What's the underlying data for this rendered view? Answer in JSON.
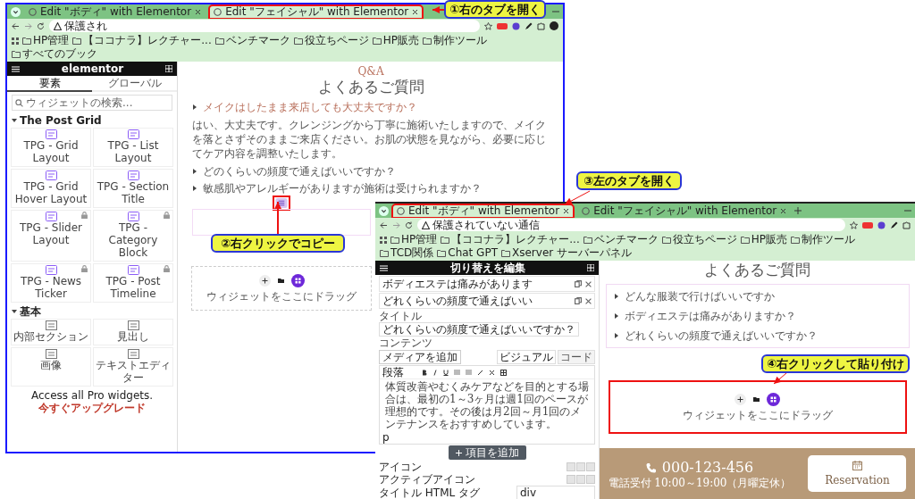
{
  "windows": [
    {
      "kind": "widgets",
      "framed": true,
      "tabs": [
        {
          "label": "Edit \"ボディ\" with Elementor",
          "selected": false,
          "highlighted": false
        },
        {
          "label": "Edit \"フェイシャル\" with Elementor",
          "selected": true,
          "highlighted": true
        }
      ],
      "address": "保護され",
      "bookmarks": [
        "HP管理",
        "【ココナラ】レクチャー...",
        "ベンチマーク",
        "役立ちページ",
        "HP販売",
        "制作ツール"
      ],
      "bookmarks_right": "すべてのブック",
      "panel": {
        "logo": "elementor",
        "tabs": [
          {
            "label": "要素",
            "selected": true
          },
          {
            "label": "グローバル",
            "selected": false
          }
        ],
        "search": {
          "placeholder": "ウィジェットの検索..."
        },
        "sections": [
          {
            "title": "The Post Grid",
            "widgets": [
              {
                "label": "TPG - Grid Layout",
                "locked": false
              },
              {
                "label": "TPG - List Layout",
                "locked": false
              },
              {
                "label": "TPG - Grid Hover Layout",
                "locked": false
              },
              {
                "label": "TPG - Section Title",
                "locked": false
              },
              {
                "label": "TPG - Slider Layout",
                "locked": true
              },
              {
                "label": "TPG - Category Block",
                "locked": true
              },
              {
                "label": "TPG - News Ticker",
                "locked": true
              },
              {
                "label": "TPG - Post Timeline",
                "locked": true
              }
            ]
          },
          {
            "title": "基本",
            "widgets": [
              {
                "label": "内部セクション",
                "locked": false
              },
              {
                "label": "見出し",
                "locked": false
              },
              {
                "label": "画像",
                "locked": false
              },
              {
                "label": "テキストエディター",
                "locked": false
              }
            ]
          }
        ],
        "promo": {
          "text": "Access all Pro widgets.",
          "link": "今すぐアップグレード"
        }
      },
      "page": {
        "eyebrow": "Q&A",
        "heading": "よくあるご質問",
        "faqs": [
          {
            "question": "メイクはしたまま来店しても大丈夫ですか？",
            "expanded": true,
            "answer": "はい、大丈夫です。クレンジングから丁寧に施術いたしますので、メイクを落とさずそのままご来店ください。お肌の状態を見ながら、必要に応じてケア内容を調整いたします。"
          },
          {
            "question": "どのくらいの頻度で通えばいいですか？",
            "expanded": false
          },
          {
            "question": "敏感肌やアレルギーがありますが施術は受けられますか？",
            "expanded": false
          }
        ],
        "handle": {
          "highlighted": true
        },
        "dropzone": {
          "hint": "ウィジェットをここにドラッグ",
          "highlighted": false
        }
      }
    },
    {
      "kind": "editor",
      "framed": false,
      "tabs": [
        {
          "label": "Edit \"ボディ\" with Elementor",
          "selected": true,
          "highlighted": true
        },
        {
          "label": "Edit \"フェイシャル\" with Elementor",
          "selected": false,
          "highlighted": false
        }
      ],
      "address": "保護されていない通信",
      "bookmarks": [
        "HP管理",
        "【ココナラ】レクチャー...",
        "ベンチマーク",
        "役立ちページ",
        "HP販売",
        "制作ツール",
        "TCD関係",
        "Chat GPT",
        "Xserver サーバーパネル"
      ],
      "panel": {
        "title": "切り替えを編集",
        "items": [
          {
            "label": "ボディエステは痛みがあります"
          },
          {
            "label": "どれくらいの頻度で通えばいい"
          }
        ],
        "title_label": "タイトル",
        "title_value": "どれくらいの頻度で通えばいいですか？",
        "content_label": "コンテンツ",
        "media_button": "メディアを追加",
        "editor_tabs": [
          {
            "label": "ビジュアル",
            "selected": true
          },
          {
            "label": "コード",
            "selected": false
          }
        ],
        "format": "段落",
        "body": "体質改善やむくみケアなどを目的とする場合は、最初の1～3ヶ月は週1回のペースが理想的です。その後は月2回～月1回のメンテナンスをおすすめしています。",
        "path": "p",
        "add_button": "項目を追加",
        "controls": [
          {
            "label": "アイコン"
          },
          {
            "label": "アクティブアイコン"
          },
          {
            "label": "タイトル HTML タグ",
            "value": "div"
          }
        ]
      },
      "page": {
        "heading": "よくあるご質問",
        "boxed": true,
        "faqs": [
          {
            "question": "どんな服装で行けばいいですか",
            "expanded": false
          },
          {
            "question": "ボディエステは痛みがありますか？",
            "expanded": false
          },
          {
            "question": "どれくらいの頻度で通えばいいですか？",
            "expanded": false
          }
        ],
        "dropzone": {
          "hint": "ウィジェットをここにドラッグ",
          "highlighted": true
        },
        "footer": {
          "phone": "000-123-456",
          "hours": "電話受付 10:00～19:00（月曜定休）",
          "button": "Reservation"
        }
      }
    }
  ],
  "callouts": [
    {
      "text": "①右のタブを開く"
    },
    {
      "text": "②右クリックでコピー"
    },
    {
      "text": "③左のタブを開く"
    },
    {
      "text": "④右クリックして貼り付け"
    }
  ]
}
